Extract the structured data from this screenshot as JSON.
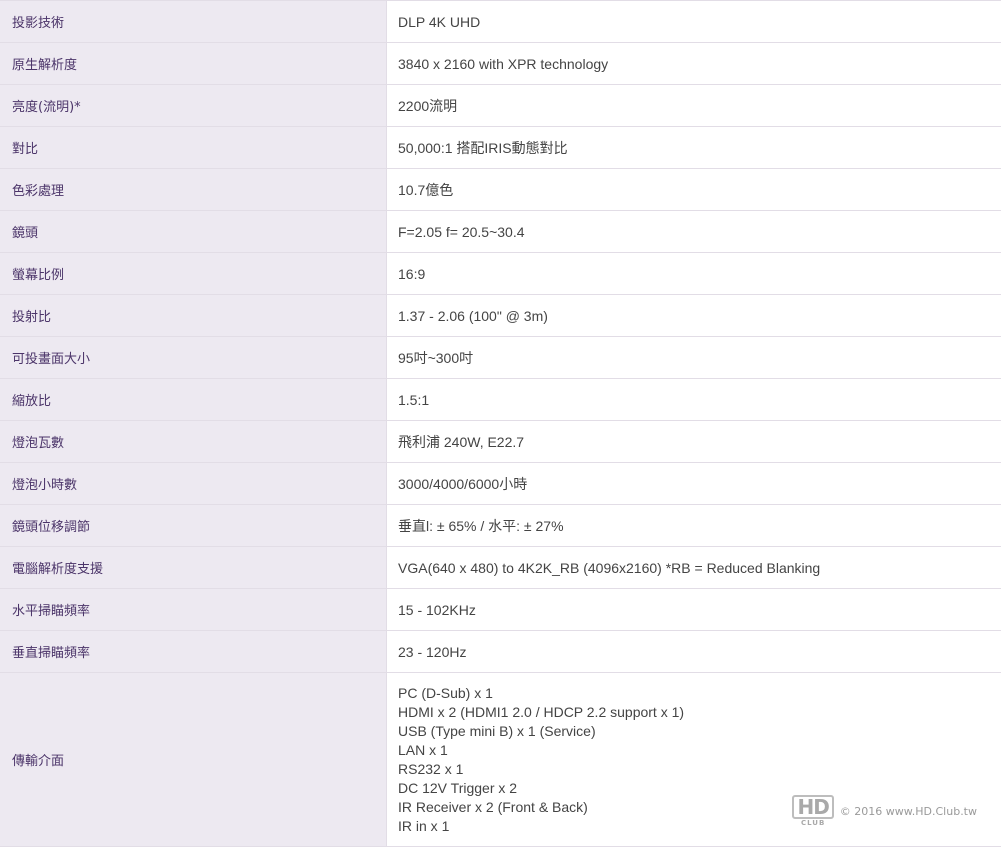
{
  "specs": [
    {
      "label": "投影技術",
      "value": "DLP 4K UHD"
    },
    {
      "label": "原生解析度",
      "value": "3840 x 2160 with XPR technology"
    },
    {
      "label": "亮度(流明)*",
      "value": "2200流明"
    },
    {
      "label": "對比",
      "value": "50,000:1 搭配IRIS動態對比"
    },
    {
      "label": "色彩處理",
      "value": "10.7億色"
    },
    {
      "label": "鏡頭",
      "value": "F=2.05 f= 20.5~30.4"
    },
    {
      "label": "螢幕比例",
      "value": "16:9"
    },
    {
      "label": "投射比",
      "value": "1.37 - 2.06 (100\" @ 3m)"
    },
    {
      "label": "可投畫面大小",
      "value": "95吋~300吋"
    },
    {
      "label": "縮放比",
      "value": "1.5:1"
    },
    {
      "label": "燈泡瓦數",
      "value": "飛利浦 240W, E22.7"
    },
    {
      "label": "燈泡小時數",
      "value": "3000/4000/6000小時"
    },
    {
      "label": "鏡頭位移調節",
      "value": "垂直l: ± 65% / 水平: ± 27%"
    },
    {
      "label": "電腦解析度支援",
      "value": "VGA(640 x 480) to 4K2K_RB (4096x2160) *RB = Reduced Blanking"
    },
    {
      "label": "水平掃瞄頻率",
      "value": "15 - 102KHz"
    },
    {
      "label": "垂直掃瞄頻率",
      "value": "23 - 120Hz"
    }
  ],
  "interface": {
    "label": "傳輸介面",
    "lines": [
      "PC (D-Sub) x 1",
      "HDMI x 2 (HDMI1 2.0 / HDCP 2.2 support x 1)",
      "USB (Type mini B) x 1 (Service)",
      "LAN x 1",
      "RS232 x 1",
      "DC 12V Trigger x 2",
      "IR Receiver x 2 (Front & Back)",
      "IR in x 1"
    ]
  },
  "watermark": {
    "logo_main": "HD",
    "logo_sub": "CLUB",
    "text": "© 2016 www.HD.Club.tw"
  }
}
